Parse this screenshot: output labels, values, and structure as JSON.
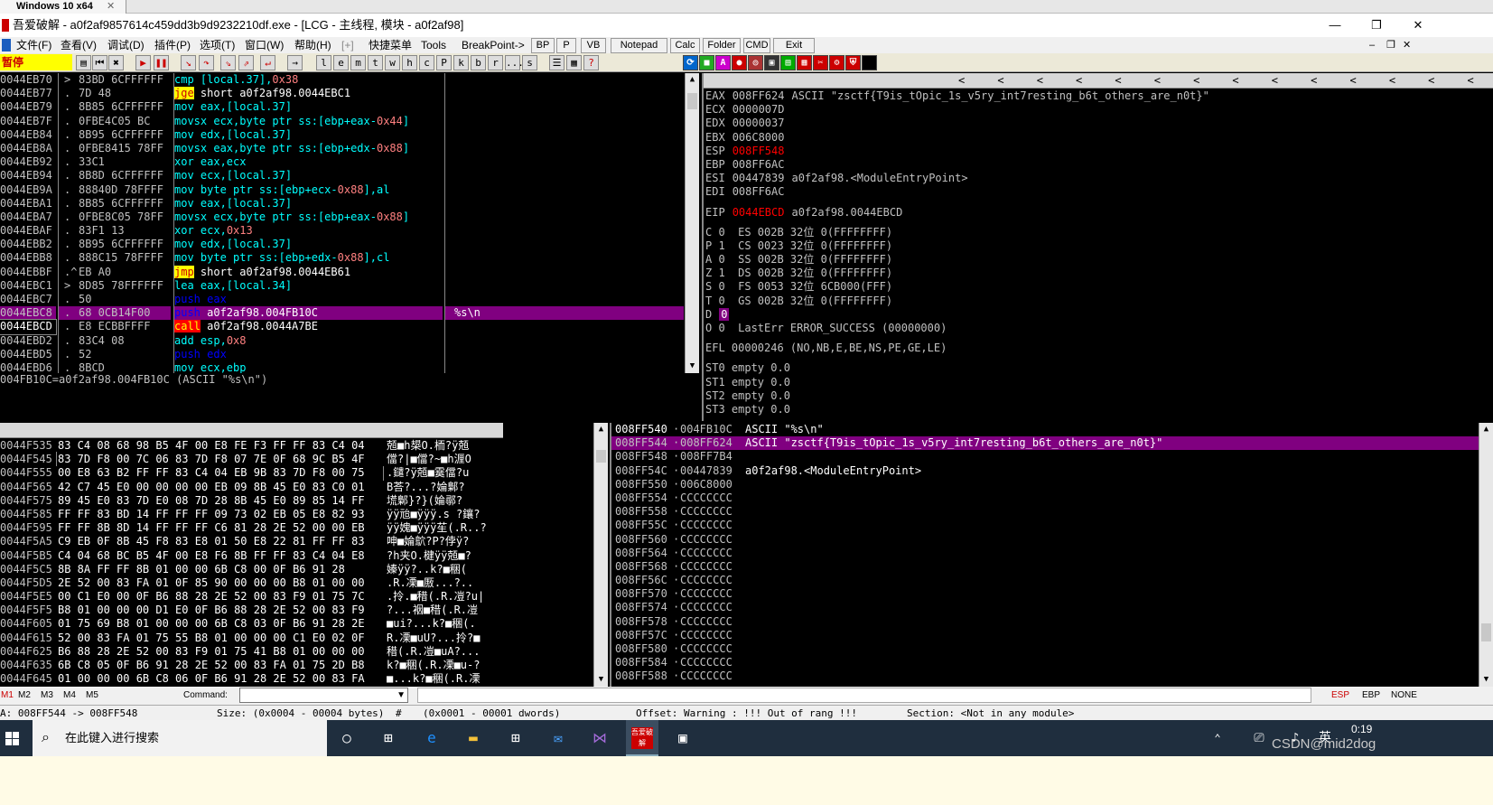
{
  "vm_tab": {
    "label": "Windows 10 x64",
    "close": "✕"
  },
  "window": {
    "title": "吾爱破解 - a0f2af9857614c459dd3b9d9232210df.exe - [LCG - 主线程, 模块 - a0f2af98]",
    "min": "—",
    "max": "❐",
    "close": "✕"
  },
  "menu": [
    "文件(F)",
    "查看(V)",
    "调试(D)",
    "插件(P)",
    "选项(T)",
    "窗口(W)",
    "帮助(H)",
    "[+]",
    "快捷菜单",
    "Tools",
    "BreakPoint->"
  ],
  "menu_buttons": [
    "BP",
    "P",
    "VB",
    "Notepad",
    "Calc",
    "Folder",
    "CMD",
    "Exit"
  ],
  "toolbar": {
    "status": "暂停",
    "letters": [
      "l",
      "e",
      "m",
      "t",
      "w",
      "h",
      "c",
      "P",
      "k",
      "b",
      "r",
      "...",
      "s"
    ]
  },
  "disasm": {
    "rows": [
      {
        "addr": "0044EB70",
        "arrow": ">",
        "bytes": "83BD 6CFFFFFF",
        "asm": "cmp [local.37],0x38",
        "kind": "normal",
        "cmt": ""
      },
      {
        "addr": "0044EB77",
        "arrow": ".",
        "bytes": "7D 48",
        "asm": "jge short a0f2af98.0044EBC1",
        "kind": "jge",
        "cmt": ""
      },
      {
        "addr": "0044EB79",
        "arrow": ".",
        "bytes": "8B85 6CFFFFFF",
        "asm": "mov eax,[local.37]",
        "kind": "normal",
        "cmt": ""
      },
      {
        "addr": "0044EB7F",
        "arrow": ".",
        "bytes": "0FBE4C05 BC",
        "asm": "movsx ecx,byte ptr ss:[ebp+eax-0x44]",
        "kind": "normal",
        "cmt": ""
      },
      {
        "addr": "0044EB84",
        "arrow": ".",
        "bytes": "8B95 6CFFFFFF",
        "asm": "mov edx,[local.37]",
        "kind": "normal",
        "cmt": ""
      },
      {
        "addr": "0044EB8A",
        "arrow": ".",
        "bytes": "0FBE8415 78FF",
        "asm": "movsx eax,byte ptr ss:[ebp+edx-0x88]",
        "kind": "normal",
        "cmt": ""
      },
      {
        "addr": "0044EB92",
        "arrow": ".",
        "bytes": "33C1",
        "asm": "xor eax,ecx",
        "kind": "normal",
        "cmt": ""
      },
      {
        "addr": "0044EB94",
        "arrow": ".",
        "bytes": "8B8D 6CFFFFFF",
        "asm": "mov ecx,[local.37]",
        "kind": "normal",
        "cmt": ""
      },
      {
        "addr": "0044EB9A",
        "arrow": ".",
        "bytes": "88840D 78FFFF",
        "asm": "mov byte ptr ss:[ebp+ecx-0x88],al",
        "kind": "normal",
        "cmt": ""
      },
      {
        "addr": "0044EBA1",
        "arrow": ".",
        "bytes": "8B85 6CFFFFFF",
        "asm": "mov eax,[local.37]",
        "kind": "normal",
        "cmt": ""
      },
      {
        "addr": "0044EBA7",
        "arrow": ".",
        "bytes": "0FBE8C05 78FF",
        "asm": "movsx ecx,byte ptr ss:[ebp+eax-0x88]",
        "kind": "normal",
        "cmt": ""
      },
      {
        "addr": "0044EBAF",
        "arrow": ".",
        "bytes": "83F1 13",
        "asm": "xor ecx,0x13",
        "kind": "normal",
        "cmt": ""
      },
      {
        "addr": "0044EBB2",
        "arrow": ".",
        "bytes": "8B95 6CFFFFFF",
        "asm": "mov edx,[local.37]",
        "kind": "normal",
        "cmt": ""
      },
      {
        "addr": "0044EBB8",
        "arrow": ".",
        "bytes": "888C15 78FFFF",
        "asm": "mov byte ptr ss:[ebp+edx-0x88],cl",
        "kind": "normal",
        "cmt": ""
      },
      {
        "addr": "0044EBBF",
        "arrow": ".^",
        "bytes": "EB A0",
        "asm": "jmp short a0f2af98.0044EB61",
        "kind": "jmp",
        "cmt": ""
      },
      {
        "addr": "0044EBC1",
        "arrow": ">",
        "bytes": "8D85 78FFFFFF",
        "asm": "lea eax,[local.34]",
        "kind": "normal",
        "cmt": ""
      },
      {
        "addr": "0044EBC7",
        "arrow": ".",
        "bytes": "50",
        "asm": "push eax",
        "kind": "push",
        "cmt": ""
      },
      {
        "addr": "0044EBC8",
        "arrow": ".",
        "bytes": "68 0CB14F00",
        "asm": "push a0f2af98.004FB10C",
        "kind": "sel",
        "cmt": "%s\\n"
      },
      {
        "addr": "0044EBCD",
        "arrow": ".",
        "bytes": "E8 ECBBFFFF",
        "asm": "call a0f2af98.0044A7BE",
        "kind": "call",
        "cmt": ""
      },
      {
        "addr": "0044EBD2",
        "arrow": ".",
        "bytes": "83C4 08",
        "asm": "add esp,0x8",
        "kind": "normal",
        "cmt": ""
      },
      {
        "addr": "0044EBD5",
        "arrow": ".",
        "bytes": "52",
        "asm": "push edx",
        "kind": "push",
        "cmt": ""
      },
      {
        "addr": "0044EBD6",
        "arrow": ".",
        "bytes": "8BCD",
        "asm": "mov ecx,ebp",
        "kind": "normal",
        "cmt": ""
      }
    ],
    "info": "004FB10C=a0f2af98.004FB10C (ASCII \"%s\\n\")"
  },
  "registers": {
    "header": "寄存器 (FPU)",
    "arrows": "<     <     <     <     <     <     <     <     <     <     <     <     <     <",
    "gpr": [
      {
        "name": "EAX",
        "val": "008FF624",
        "rest": "ASCII \"zsctf{T9is_tOpic_1s_v5ry_int7resting_b6t_others_are_n0t}\"",
        "red": false
      },
      {
        "name": "ECX",
        "val": "0000007D",
        "rest": "",
        "red": false
      },
      {
        "name": "EDX",
        "val": "00000037",
        "rest": "",
        "red": false
      },
      {
        "name": "EBX",
        "val": "006C8000",
        "rest": "",
        "red": false
      },
      {
        "name": "ESP",
        "val": "008FF548",
        "rest": "",
        "red": true
      },
      {
        "name": "EBP",
        "val": "008FF6AC",
        "rest": "",
        "red": false
      },
      {
        "name": "ESI",
        "val": "00447839",
        "rest": "a0f2af98.<ModuleEntryPoint>",
        "red": false
      },
      {
        "name": "EDI",
        "val": "008FF6AC",
        "rest": "",
        "red": false
      }
    ],
    "eip": {
      "name": "EIP",
      "val": "0044EBCD",
      "rest": "a0f2af98.0044EBCD"
    },
    "flags": [
      "C 0  ES 002B 32位 0(FFFFFFFF)",
      "P 1  CS 0023 32位 0(FFFFFFFF)",
      "A 0  SS 002B 32位 0(FFFFFFFF)",
      "Z 1  DS 002B 32位 0(FFFFFFFF)",
      "S 0  FS 0053 32位 6CB000(FFF)",
      "T 0  GS 002B 32位 0(FFFFFFFF)"
    ],
    "dflag": "D",
    "dval": "0",
    "lasterr": "O 0  LastErr ERROR_SUCCESS (00000000)",
    "efl": "EFL 00000246 (NO,NB,E,BE,NS,PE,GE,LE)",
    "fpu": [
      "ST0 empty 0.0",
      "ST1 empty 0.0",
      "ST2 empty 0.0",
      "ST3 empty 0.0"
    ]
  },
  "dump": {
    "h_addr": "地址",
    "h_hex": "HEX 数据",
    "h_ascii": "ASCII",
    "rows": [
      {
        "addr": "0044F535",
        "hex": "83 C4 08 68 98 B5 4F 00 E8 FE F3 FF FF 83 C4 04",
        "ascii": "兡■h槼O.栭?ÿ兡"
      },
      {
        "addr": "0044F545",
        "hex": "83 7D F8 00 7C 06 83 7D F8 07 7E 0F 68 9C B5 4F",
        "ascii": "儅?|■儅?~■h湹O"
      },
      {
        "addr": "0044F555",
        "hex": "00 E8 63 B2 FF FF 83 C4 04 EB 9B 83 7D F8 00 75",
        "ascii": ".鑓?ÿ兡■霙儅?u"
      },
      {
        "addr": "0044F565",
        "hex": "42 C7 45 E0 00 00 00 00 EB 09 8B 45 E0 83 C0 01",
        "ascii": "B荅?...?婨鄡?"
      },
      {
        "addr": "0044F575",
        "hex": "89 45 E0 83 7D E0 08 7D 28 8B 45 E0 89 85 14 FF",
        "ascii": "塃鄡}?}(婨鄩?"
      },
      {
        "addr": "0044F585",
        "hex": "FF FF 83 BD 14 FF FF FF 09 73 02 EB 05 E8 82 93",
        "ascii": "ÿÿ兘■ÿÿÿ.s ?鑲?"
      },
      {
        "addr": "0044F595",
        "hex": "FF FF 8B 8D 14 FF FF FF C6 81 28 2E 52 00 00 EB",
        "ascii": "ÿÿ媿■ÿÿÿ苼(.R..?"
      },
      {
        "addr": "0044F5A5",
        "hex": "C9 EB 0F 8B 45 F8 83 E8 01 50 E8 22 81 FF FF 83",
        "ascii": "呻■婨鴥?P?侼ÿ?"
      },
      {
        "addr": "0044F5B5",
        "hex": "C4 04 68 BC B5 4F 00 E8 F6 8B FF FF 83 C4 04 E8",
        "ascii": "?h夹O.楗ÿÿ兡■?"
      },
      {
        "addr": "0044F5C5",
        "hex": "8B 8A FF FF 8B 01 00 00 6B C8 00 0F B6 91 28",
        "ascii": "嫀ÿÿ?..k?■稇("
      },
      {
        "addr": "0044F5D5",
        "hex": "2E 52 00 83 FA 01 0F 85 90 00 00 00 B8 01 00 00",
        "ascii": ".R.凓■厫...?.."
      },
      {
        "addr": "0044F5E5",
        "hex": "00 C1 E0 00 0F B6 88 28 2E 52 00 83 F9 01 75 7C",
        "ascii": ".拎.■稓(.R.凒?u|"
      },
      {
        "addr": "0044F5F5",
        "hex": "B8 01 00 00 00 D1 E0 0F B6 88 28 2E 52 00 83 F9",
        "ascii": "?...裀■稓(.R.凒"
      },
      {
        "addr": "0044F605",
        "hex": "01 75 69 B8 01 00 00 00 6B C8 03 0F B6 91 28 2E",
        "ascii": "■ui?...k?■稇(."
      },
      {
        "addr": "0044F615",
        "hex": "52 00 83 FA 01 75 55 B8 01 00 00 00 C1 E0 02 0F",
        "ascii": "R.凓■uU?...拎?■"
      },
      {
        "addr": "0044F625",
        "hex": "B6 88 28 2E 52 00 83 F9 01 75 41 B8 01 00 00 00",
        "ascii": "稓(.R.凒■uA?..."
      },
      {
        "addr": "0044F635",
        "hex": "6B C8 05 0F B6 91 28 2E 52 00 83 FA 01 75 2D B8",
        "ascii": "k?■稇(.R.凓■u-?"
      },
      {
        "addr": "0044F645",
        "hex": "01 00 00 00 6B C8 06 0F B6 91 28 2E 52 00 83 FA",
        "ascii": "■...k?■稇(.R.凓"
      }
    ]
  },
  "stack": {
    "rows": [
      {
        "addr": "008FF540",
        "val": "004FB10C",
        "cmt": "ASCII \"%s\\n\"",
        "sel": false
      },
      {
        "addr": "008FF544",
        "val": "008FF624",
        "cmt": "ASCII \"zsctf{T9is_tOpic_1s_v5ry_int7resting_b6t_others_are_n0t}\"",
        "sel": true
      },
      {
        "addr": "008FF548",
        "val": "008FF7B4",
        "cmt": "",
        "sel": false
      },
      {
        "addr": "008FF54C",
        "val": "00447839",
        "cmt": "a0f2af98.<ModuleEntryPoint>",
        "sel": false
      },
      {
        "addr": "008FF550",
        "val": "006C8000",
        "cmt": "",
        "sel": false
      },
      {
        "addr": "008FF554",
        "val": "CCCCCCCC",
        "cmt": "",
        "sel": false
      },
      {
        "addr": "008FF558",
        "val": "CCCCCCCC",
        "cmt": "",
        "sel": false
      },
      {
        "addr": "008FF55C",
        "val": "CCCCCCCC",
        "cmt": "",
        "sel": false
      },
      {
        "addr": "008FF560",
        "val": "CCCCCCCC",
        "cmt": "",
        "sel": false
      },
      {
        "addr": "008FF564",
        "val": "CCCCCCCC",
        "cmt": "",
        "sel": false
      },
      {
        "addr": "008FF568",
        "val": "CCCCCCCC",
        "cmt": "",
        "sel": false
      },
      {
        "addr": "008FF56C",
        "val": "CCCCCCCC",
        "cmt": "",
        "sel": false
      },
      {
        "addr": "008FF570",
        "val": "CCCCCCCC",
        "cmt": "",
        "sel": false
      },
      {
        "addr": "008FF574",
        "val": "CCCCCCCC",
        "cmt": "",
        "sel": false
      },
      {
        "addr": "008FF578",
        "val": "CCCCCCCC",
        "cmt": "",
        "sel": false
      },
      {
        "addr": "008FF57C",
        "val": "CCCCCCCC",
        "cmt": "",
        "sel": false
      },
      {
        "addr": "008FF580",
        "val": "CCCCCCCC",
        "cmt": "",
        "sel": false
      },
      {
        "addr": "008FF584",
        "val": "CCCCCCCC",
        "cmt": "",
        "sel": false
      },
      {
        "addr": "008FF588",
        "val": "CCCCCCCC",
        "cmt": "",
        "sel": false
      }
    ]
  },
  "command_bar": {
    "m_buttons": [
      "M1",
      "M2",
      "M3",
      "M4",
      "M5"
    ],
    "label": "Command:",
    "esp": "ESP",
    "ebp": "EBP",
    "none": "NONE"
  },
  "status_bar": {
    "range": "A: 008FF544 -> 008FF548",
    "size": "Size: (0x0004 - 00004 bytes)",
    "hash": "#",
    "dwords": "(0x0001 - 00001 dwords)",
    "offset": "Offset: Warning : !!! Out of rang !!!",
    "section": "Section: <Not in any module>"
  },
  "taskbar": {
    "search": "在此键入进行搜索",
    "app_label": "吾爱破解",
    "ime": "英",
    "time": "0:19",
    "watermark": "CSDN@mid2dog"
  },
  "colors": {
    "selection": "#800080",
    "jump": "#ffff00",
    "call_bg": "#ff0000",
    "push": "#0000ff",
    "number": "#ff8080",
    "reg": "#00ffff"
  }
}
